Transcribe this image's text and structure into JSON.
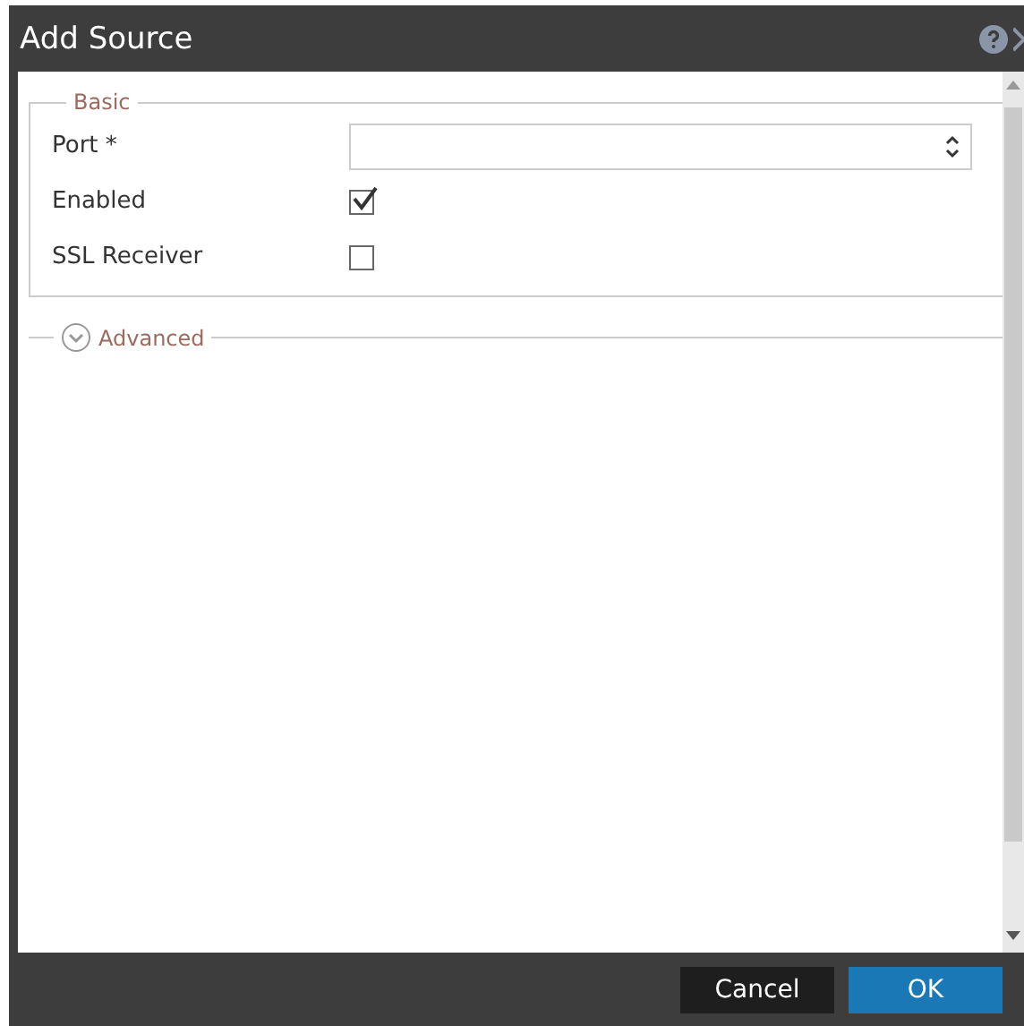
{
  "window": {
    "title": "Add Source"
  },
  "basic": {
    "legend": "Basic",
    "fields": [
      {
        "kind": "select",
        "label": "Port *"
      },
      {
        "kind": "checkbox",
        "label": "Enabled",
        "checked": true
      },
      {
        "kind": "checkbox",
        "label": "SSL Receiver",
        "checked": false
      }
    ]
  },
  "advanced": {
    "label": "Advanced",
    "expanded": false
  },
  "buttons": [
    {
      "label": "Cancel",
      "kind": "secondary"
    },
    {
      "label": "OK",
      "kind": "primary"
    }
  ]
}
